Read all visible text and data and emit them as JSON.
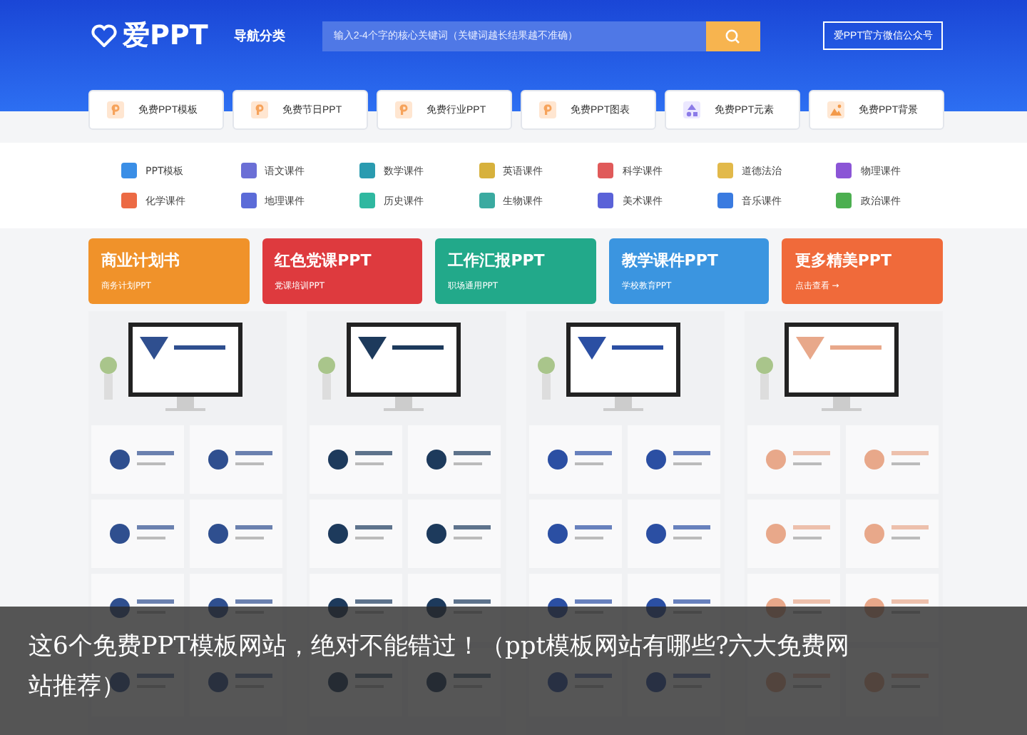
{
  "header": {
    "logo": "爱PPT",
    "nav": "导航分类",
    "search": {
      "placeholder": "输入2-4个字的核心关键词（关键词越长结果越不准确）"
    },
    "wechat_button": "爱PPT官方微信公众号"
  },
  "quick_links": [
    {
      "label": "免费PPT模板",
      "kind": "doc"
    },
    {
      "label": "免费节日PPT",
      "kind": "doc"
    },
    {
      "label": "免费行业PPT",
      "kind": "doc"
    },
    {
      "label": "免费PPT图表",
      "kind": "doc"
    },
    {
      "label": "免费PPT元素",
      "kind": "shapes"
    },
    {
      "label": "免费PPT背景",
      "kind": "image"
    }
  ],
  "categories": [
    {
      "label": "PPT模板",
      "color": "#3a8ee6"
    },
    {
      "label": "语文课件",
      "color": "#6b6fd6"
    },
    {
      "label": "数学课件",
      "color": "#2a9bb0"
    },
    {
      "label": "英语课件",
      "color": "#d7b13c"
    },
    {
      "label": "科学课件",
      "color": "#e05a5a"
    },
    {
      "label": "道德法治",
      "color": "#e2b94a"
    },
    {
      "label": "物理课件",
      "color": "#8b55d6"
    },
    {
      "label": "化学课件",
      "color": "#ec6a44"
    },
    {
      "label": "地理课件",
      "color": "#5b6bd8"
    },
    {
      "label": "历史课件",
      "color": "#2fb8a0"
    },
    {
      "label": "生物课件",
      "color": "#3aaaa0"
    },
    {
      "label": "美术课件",
      "color": "#5a62d8"
    },
    {
      "label": "音乐课件",
      "color": "#3a7be0"
    },
    {
      "label": "政治课件",
      "color": "#4caf50"
    }
  ],
  "banners": [
    {
      "title": "商业计划书",
      "subtitle": "商务计划PPT",
      "color": "#f0922a"
    },
    {
      "title": "红色党课PPT",
      "subtitle": "党课培训PPT",
      "color": "#de3a3e"
    },
    {
      "title": "工作汇报PPT",
      "subtitle": "职场通用PPT",
      "color": "#22a98a"
    },
    {
      "title": "教学课件PPT",
      "subtitle": "学校教育PPT",
      "color": "#3b95e0"
    },
    {
      "title": "更多精美PPT",
      "subtitle": "点击查看 →",
      "color": "#f06a3a"
    }
  ],
  "caption": "这6个免费PPT模板网站，绝对不能错过！（ppt模板网站有哪些?六大免费网站推荐）"
}
